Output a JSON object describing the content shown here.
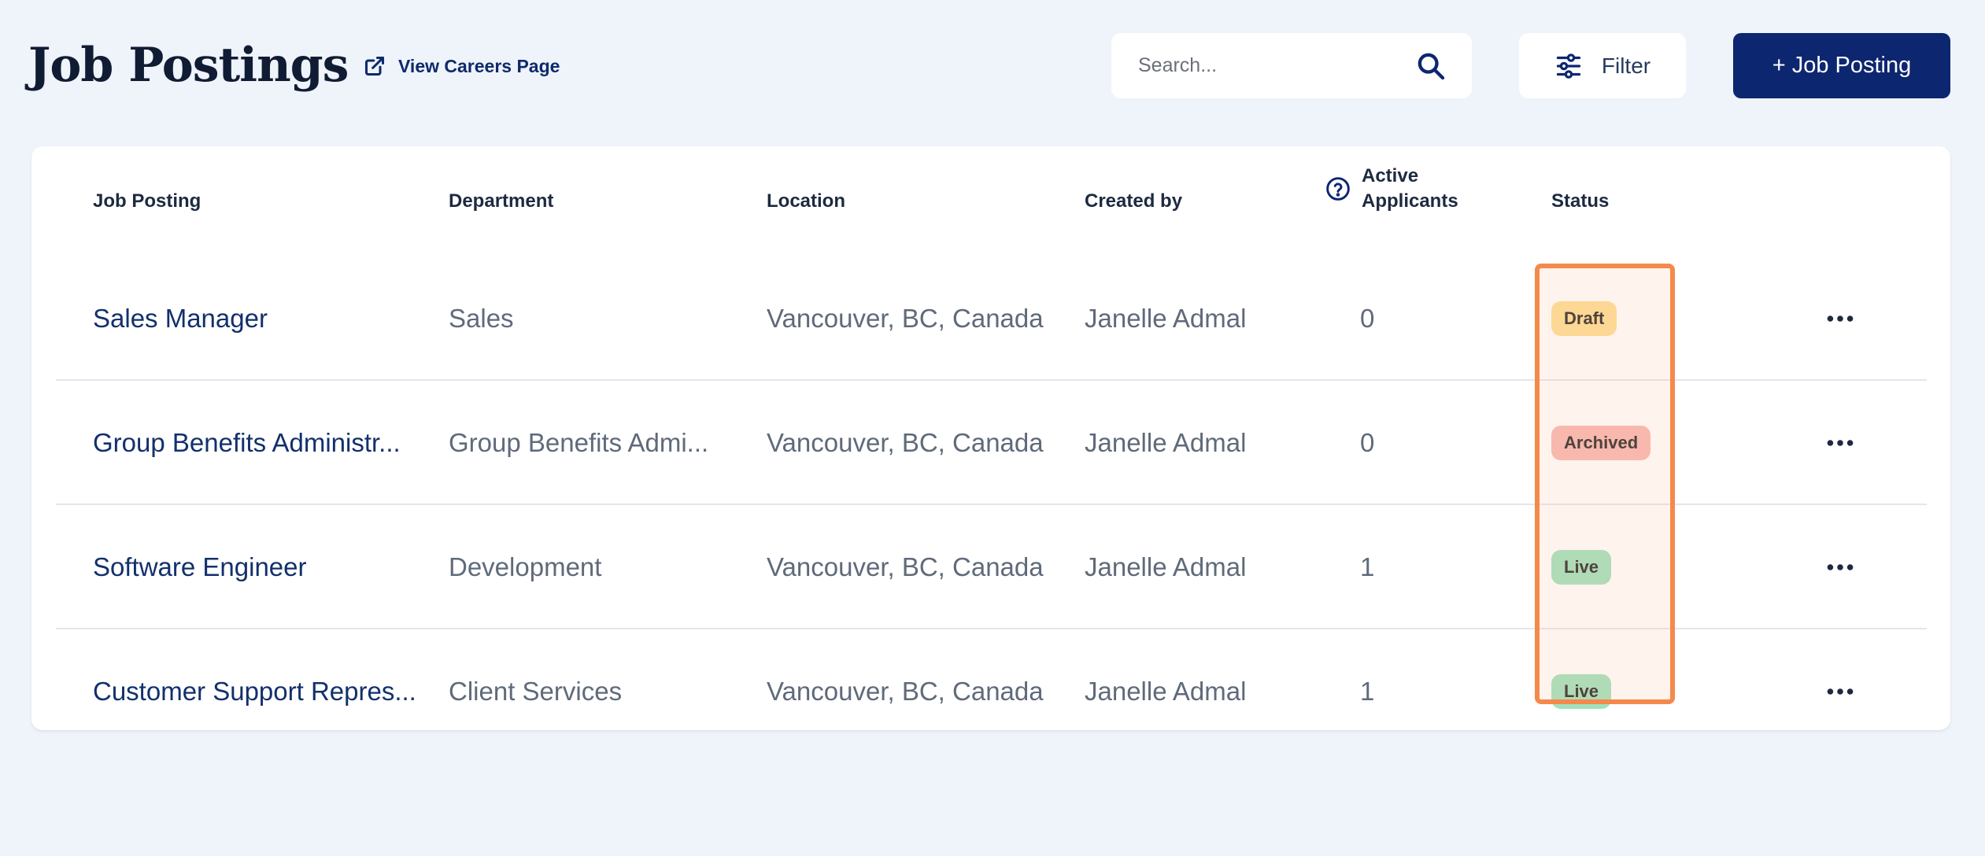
{
  "header": {
    "title": "Job Postings",
    "careers_link": "View Careers Page",
    "search_placeholder": "Search...",
    "filter_label": "Filter",
    "add_button": "+ Job Posting"
  },
  "table": {
    "columns": {
      "job_posting": "Job Posting",
      "department": "Department",
      "location": "Location",
      "created_by": "Created by",
      "active_applicants": "Active Applicants",
      "status": "Status"
    },
    "rows": [
      {
        "title": "Sales Manager",
        "department": "Sales",
        "location": "Vancouver, BC, Canada",
        "created_by": "Janelle Admal",
        "applicants": "0",
        "status": "Draft"
      },
      {
        "title": "Group Benefits Administr...",
        "department": "Group Benefits Admi...",
        "location": "Vancouver, BC, Canada",
        "created_by": "Janelle Admal",
        "applicants": "0",
        "status": "Archived"
      },
      {
        "title": "Software Engineer",
        "department": "Development",
        "location": "Vancouver, BC, Canada",
        "created_by": "Janelle Admal",
        "applicants": "1",
        "status": "Live"
      },
      {
        "title": "Customer Support Repres...",
        "department": "Client Services",
        "location": "Vancouver, BC, Canada",
        "created_by": "Janelle Admal",
        "applicants": "1",
        "status": "Live"
      }
    ]
  },
  "status_colors": {
    "Draft": "#fdde94",
    "Archived": "#f7b8b3",
    "Live": "#9fe2bd"
  },
  "colors": {
    "background": "#eff3fa",
    "primary": "#0d2670",
    "link": "#12306c",
    "highlight": "#f5894b"
  },
  "icons": {
    "careers_link": "external-link-icon",
    "search": "search-icon",
    "filter": "sliders-icon",
    "applicants_help": "help-circle-icon",
    "row_actions": "more-horizontal-icon"
  }
}
